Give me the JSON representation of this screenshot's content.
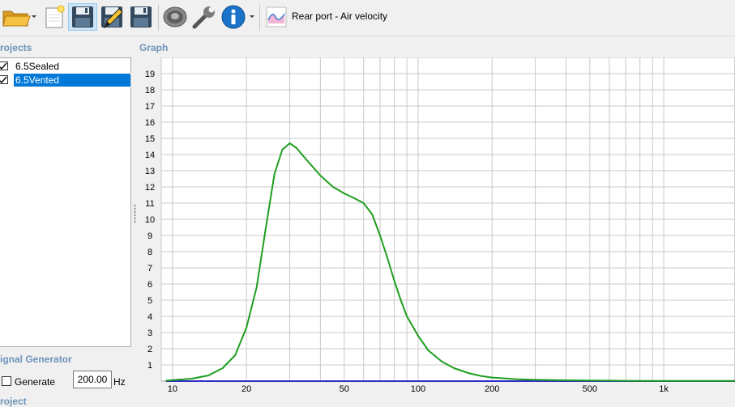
{
  "toolbar": {
    "buttons": [
      {
        "name": "open-project-button",
        "icon": "folder-open-icon"
      },
      {
        "name": "new-project-button",
        "icon": "new-document-icon"
      },
      {
        "name": "save-project-button",
        "icon": "floppy-disk-icon"
      },
      {
        "name": "edit-project-button",
        "icon": "pencil-floppy-icon"
      },
      {
        "name": "save-as-button",
        "icon": "floppy-disk-icon"
      },
      {
        "name": "driver-button",
        "icon": "speaker-icon"
      },
      {
        "name": "settings-button",
        "icon": "wrench-icon"
      },
      {
        "name": "info-button",
        "icon": "info-icon"
      },
      {
        "name": "graph-mode-button",
        "icon": "chart-icon"
      }
    ],
    "graph_mode_label": "Rear port - Air velocity"
  },
  "projects": {
    "title": "rojects",
    "items": [
      {
        "label": "6.5Sealed",
        "checked": true,
        "selected": false
      },
      {
        "label": "6.5Vented",
        "checked": true,
        "selected": true
      }
    ]
  },
  "signal_generator": {
    "title": "ignal Generator",
    "generate_label": "Generate",
    "generate_checked": false,
    "frequency_value": "200.00",
    "frequency_unit": "Hz"
  },
  "project_section": {
    "title": "roject"
  },
  "graph": {
    "title": "Graph",
    "colors": {
      "grid": "#c8c8c8",
      "curve": "#1f9e1f",
      "baseline": "#2f2fc8",
      "background": "#ffffff"
    },
    "chart_data": {
      "type": "line",
      "x_scale": "log",
      "xlim": [
        9,
        1950
      ],
      "ylim": [
        0,
        20
      ],
      "y_ticks": [
        "1",
        "2",
        "3",
        "4",
        "5",
        "6",
        "7",
        "8",
        "9",
        "10",
        "11",
        "12",
        "13",
        "14",
        "15",
        "16",
        "17",
        "18",
        "19"
      ],
      "x_ticks": [
        {
          "value": 10,
          "label": "10"
        },
        {
          "value": 20,
          "label": "20"
        },
        {
          "value": 50,
          "label": "50"
        },
        {
          "value": 100,
          "label": "100"
        },
        {
          "value": 200,
          "label": "200"
        },
        {
          "value": 500,
          "label": "500"
        },
        {
          "value": 1000,
          "label": "1k"
        }
      ],
      "series": [
        {
          "color": "#1f9e1f",
          "x": [
            9.4,
            12,
            14,
            16,
            18,
            20,
            22,
            24,
            26,
            28,
            30,
            32,
            35,
            40,
            45,
            50,
            55,
            60,
            65,
            70,
            75,
            80,
            85,
            90,
            100,
            110,
            125,
            140,
            160,
            180,
            200,
            250,
            300,
            400,
            500,
            700,
            1000,
            1500,
            1950
          ],
          "y": [
            0.03,
            0.15,
            0.35,
            0.8,
            1.6,
            3.3,
            5.8,
            9.5,
            12.8,
            14.3,
            14.7,
            14.4,
            13.7,
            12.7,
            12.0,
            11.6,
            11.3,
            11.0,
            10.3,
            9.0,
            7.6,
            6.2,
            5.0,
            4.0,
            2.8,
            1.9,
            1.2,
            0.8,
            0.5,
            0.32,
            0.22,
            0.12,
            0.08,
            0.05,
            0.04,
            0.02,
            0.015,
            0.01,
            0.01
          ]
        },
        {
          "color": "#2f2fc8",
          "x": [
            9.4,
            1950
          ],
          "y": [
            0,
            0
          ]
        }
      ]
    }
  }
}
